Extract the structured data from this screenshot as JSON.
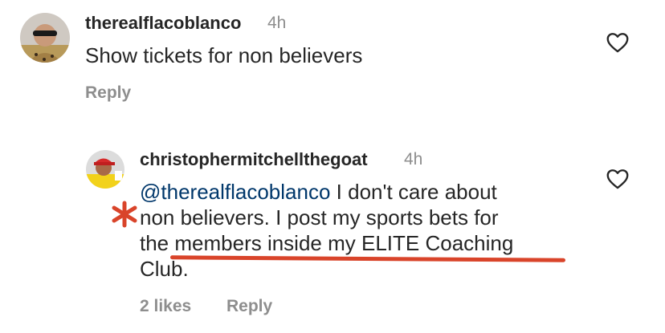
{
  "comment1": {
    "username": "therealflacoblanco",
    "time": "4h",
    "text": "Show tickets for non believers",
    "reply_label": "Reply",
    "like_icon": "heart-outline-icon"
  },
  "comment2": {
    "username": "christophermitchellthegoat",
    "time": "4h",
    "mention": "@therealflacoblanco",
    "text_line1": " I don't care about",
    "text_line2": "non believers. I post my sports bets for",
    "text_line3": "the members inside my ELITE Coaching",
    "text_line4": "Club.",
    "likes_label": "2 likes",
    "reply_label": "Reply",
    "like_icon": "heart-outline-icon"
  },
  "annotation": {
    "color": "#d9442a",
    "marks": [
      "asterisk",
      "underline"
    ]
  }
}
